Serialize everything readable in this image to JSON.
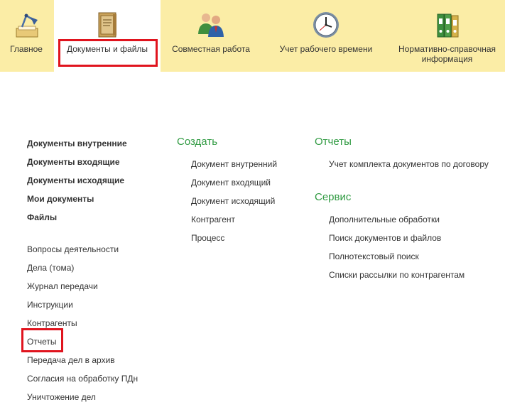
{
  "sections": [
    {
      "label": "Главное",
      "icon": "desk-lamp-icon"
    },
    {
      "label": "Документы и файлы",
      "icon": "document-folder-icon"
    },
    {
      "label": "Совместная работа",
      "icon": "people-icon"
    },
    {
      "label": "Учет рабочего времени",
      "icon": "clock-icon"
    },
    {
      "label": "Нормативно-справочная информация",
      "icon": "binders-icon"
    }
  ],
  "active_section": "Документы и файлы",
  "left_column": {
    "main_links": [
      "Документы внутренние",
      "Документы входящие",
      "Документы исходящие",
      "Мои документы",
      "Файлы"
    ],
    "other_links": [
      "Вопросы деятельности",
      "Дела (тома)",
      "Журнал передачи",
      "Инструкции",
      "Контрагенты",
      "Отчеты",
      "Передача дел в архив",
      "Согласия на обработку ПДн",
      "Уничтожение дел"
    ]
  },
  "create_group": {
    "title": "Создать",
    "items": [
      "Документ внутренний",
      "Документ входящий",
      "Документ исходящий",
      "Контрагент",
      "Процесс"
    ]
  },
  "reports_group": {
    "title": "Отчеты",
    "items": [
      "Учет комплекта документов по договору"
    ]
  },
  "service_group": {
    "title": "Сервис",
    "items": [
      "Дополнительные обработки",
      "Поиск документов и файлов",
      "Полнотекстовый поиск",
      "Списки рассылки по контрагентам"
    ]
  },
  "colors": {
    "topbar": "#fbeda6",
    "group_title": "#2f9a41",
    "highlight": "#e0141e"
  }
}
